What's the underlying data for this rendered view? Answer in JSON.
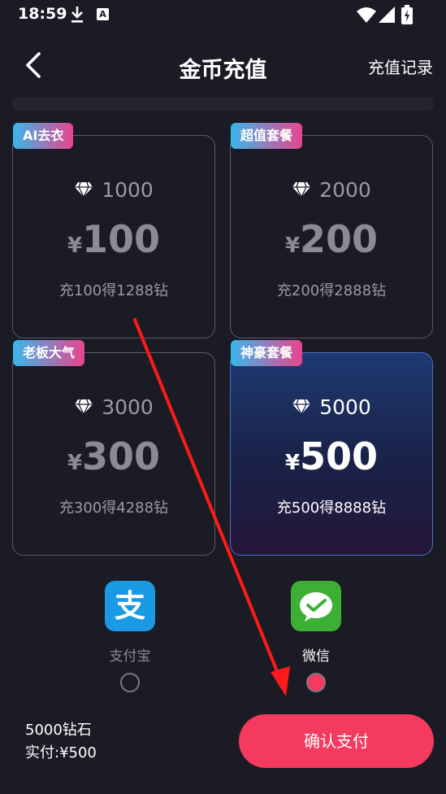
{
  "status_bar": {
    "time": "18:59",
    "notif_letter": "A"
  },
  "header": {
    "title": "金币充值",
    "records_label": "充值记录"
  },
  "packages": [
    {
      "badge": "AI去衣",
      "diamonds": "1000",
      "currency": "¥",
      "price": "100",
      "subtitle": "充100得1288钻",
      "selected": false
    },
    {
      "badge": "超值套餐",
      "diamonds": "2000",
      "currency": "¥",
      "price": "200",
      "subtitle": "充200得2888钻",
      "selected": false
    },
    {
      "badge": "老板大气",
      "diamonds": "3000",
      "currency": "¥",
      "price": "300",
      "subtitle": "充300得4288钻",
      "selected": false
    },
    {
      "badge": "神豪套餐",
      "diamonds": "5000",
      "currency": "¥",
      "price": "500",
      "subtitle": "充500得8888钻",
      "selected": true
    }
  ],
  "payment_methods": [
    {
      "name": "支付宝",
      "icon": "alipay-icon",
      "selected": false
    },
    {
      "name": "微信",
      "icon": "wechat-icon",
      "selected": true
    }
  ],
  "summary": {
    "diamonds_line": "5000钻石",
    "paid_line": "实付:¥500"
  },
  "confirm_label": "确认支付",
  "colors": {
    "accent": "#f53a5f",
    "background": "#1b1b26",
    "badge_from": "#39b7ea",
    "badge_to": "#e8458e",
    "annotation_arrow": "#ff1a1a"
  }
}
